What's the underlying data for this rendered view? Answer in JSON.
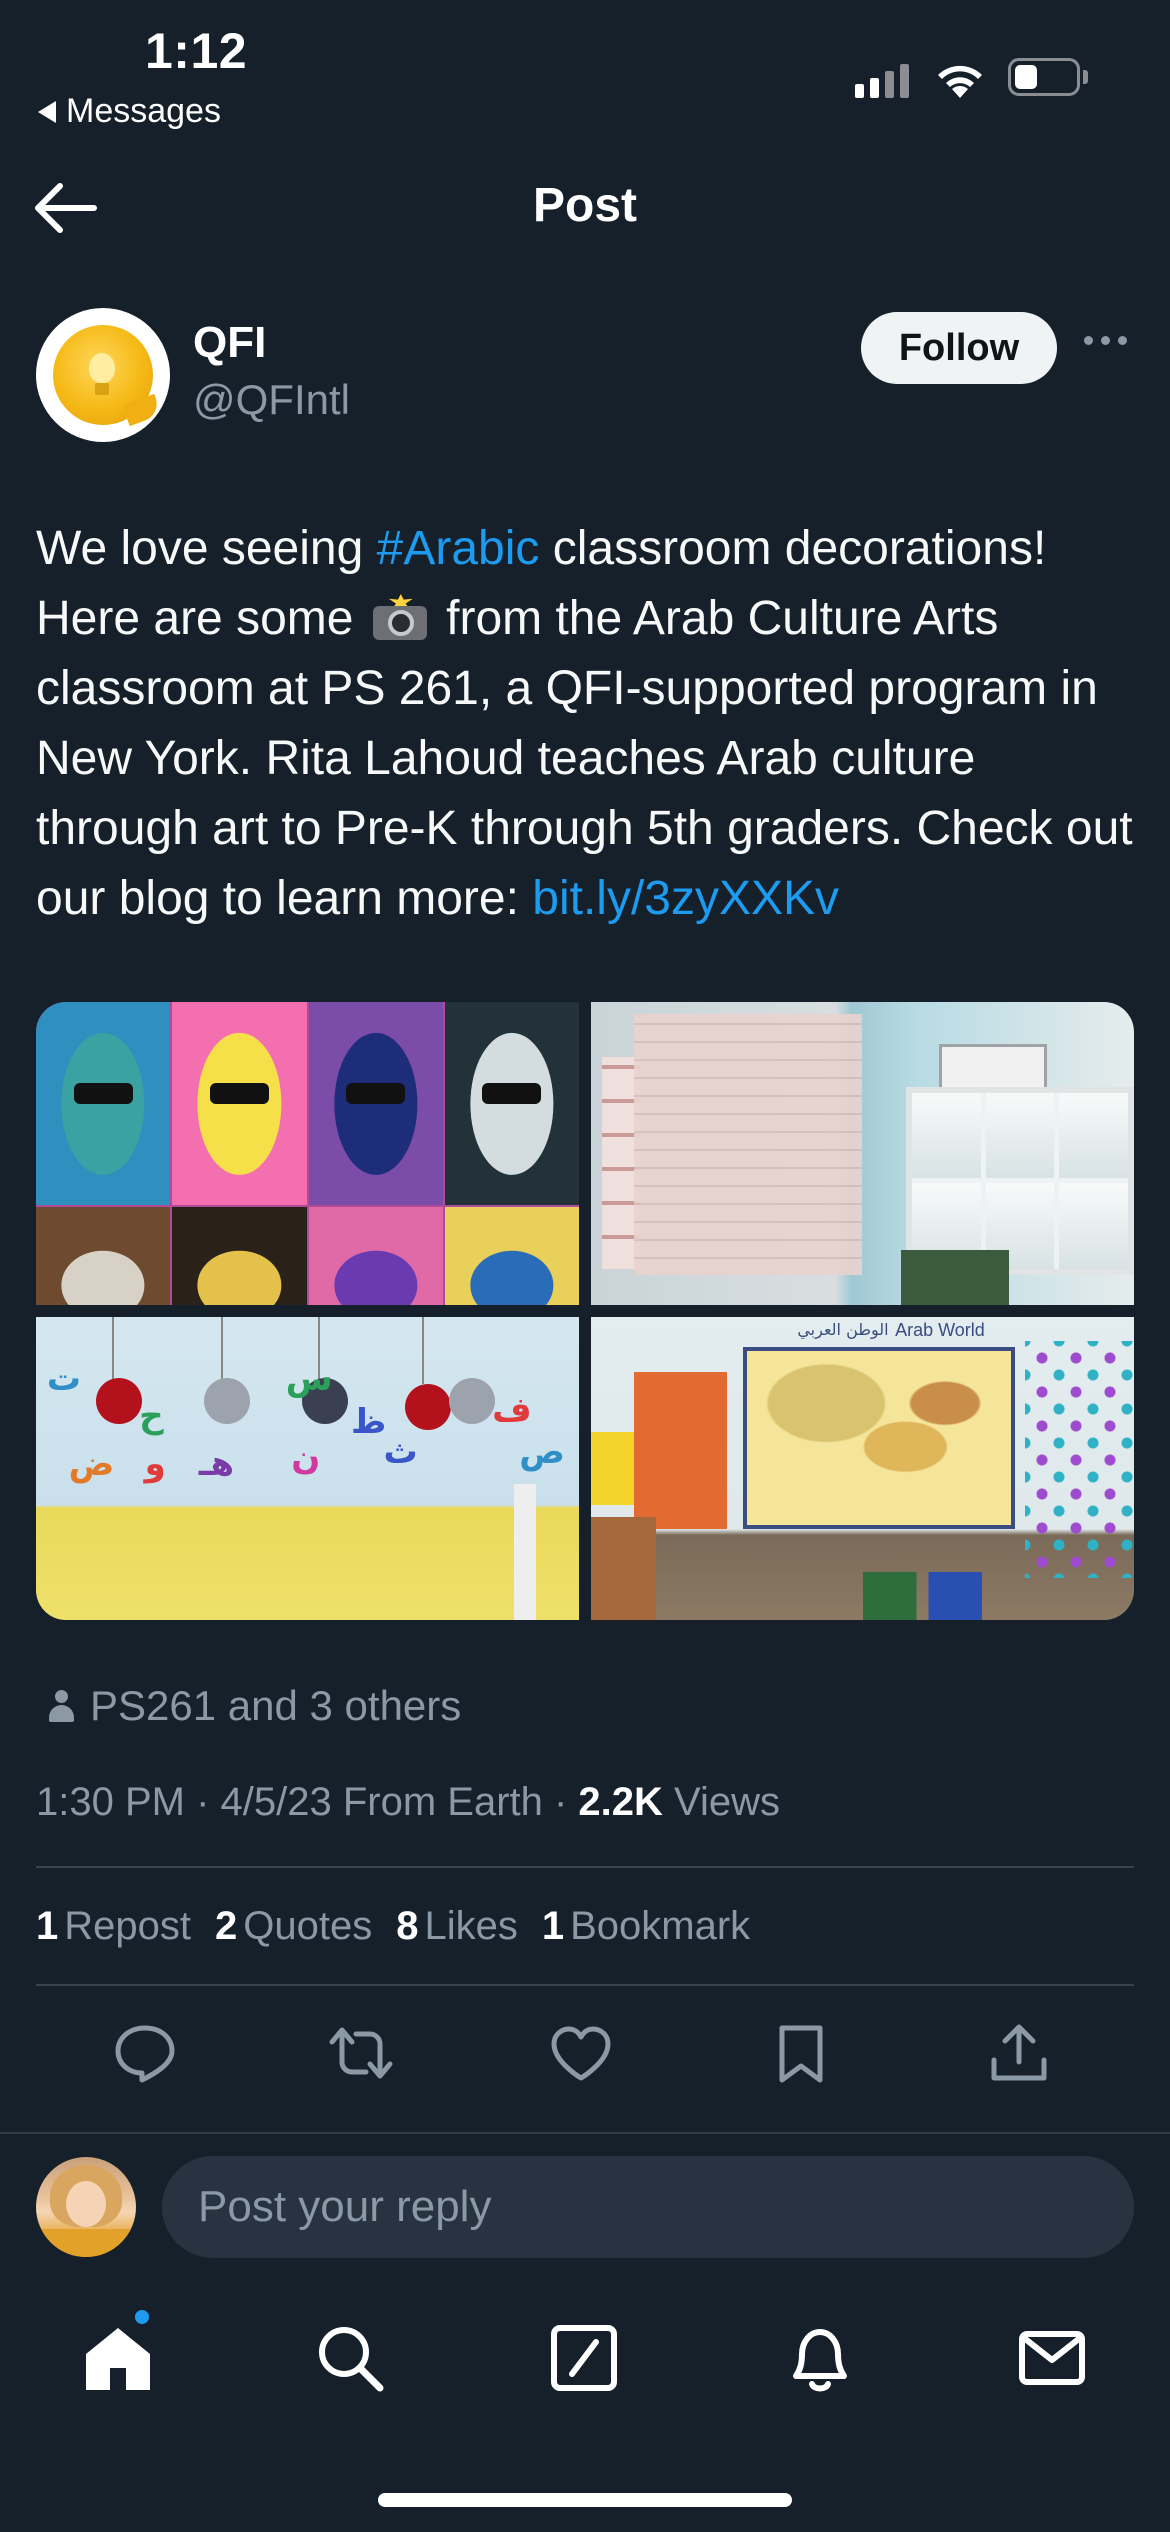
{
  "status_bar": {
    "time": "1:12",
    "back_app": "Messages"
  },
  "header": {
    "title": "Post",
    "back_icon": "arrow-left-icon"
  },
  "author": {
    "name": "QFI",
    "handle": "@QFIntl",
    "follow_label": "Follow"
  },
  "post": {
    "text_before_hashtag": "We love seeing ",
    "hashtag": "#Arabic",
    "text_after_hashtag": " classroom decorations! Here are some ",
    "emoji": "camera-with-flash-icon",
    "text_after_emoji": " from the Arab Culture Arts classroom at PS 261, a QFI-supported program in New York. Rita Lahoud teaches Arab culture through art to Pre-K through 5th graders. Check out our blog to learn more: ",
    "link": "bit.ly/3zyXXKv"
  },
  "media": {
    "photos": [
      "portraits-art-photo",
      "classroom-wall-photo",
      "arabic-letters-photo",
      "arab-world-map-photo"
    ],
    "tile4_sign_1": "الوطن العربي",
    "tile4_sign_2": "Arab World"
  },
  "meta": {
    "tagged": "PS261 and 3 others",
    "timestamp": "1:30 PM · 4/5/23 From Earth · ",
    "views_count": "2.2K",
    "views_label": " Views"
  },
  "stats": [
    {
      "count": "1",
      "label": "Repost"
    },
    {
      "count": "2",
      "label": "Quotes"
    },
    {
      "count": "8",
      "label": "Likes"
    },
    {
      "count": "1",
      "label": "Bookmark"
    }
  ],
  "actions": [
    "reply-icon",
    "repost-icon",
    "like-icon",
    "bookmark-icon",
    "share-icon"
  ],
  "reply": {
    "placeholder": "Post your reply"
  },
  "tab_bar": [
    "home-icon",
    "search-icon",
    "compose-icon",
    "notifications-icon",
    "messages-icon"
  ],
  "colors": {
    "background": "#15202b",
    "accent": "#1d9bf0",
    "secondary_text": "#8b98a5",
    "divider": "#38444d"
  }
}
